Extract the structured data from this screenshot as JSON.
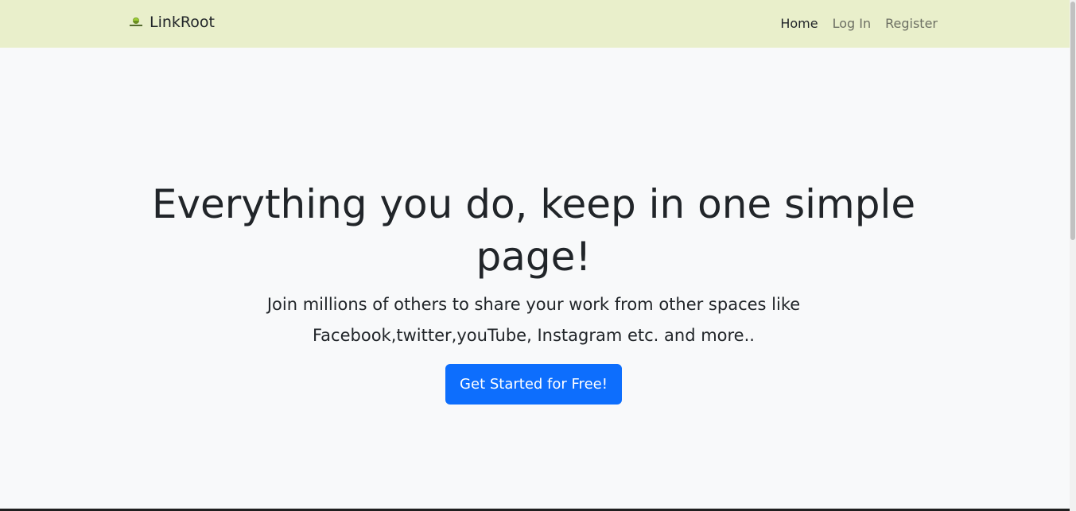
{
  "nav": {
    "brand": "LinkRoot",
    "logo_icon": "linkroot-logo-icon",
    "links": [
      {
        "label": "Home",
        "active": true
      },
      {
        "label": "Log In",
        "active": false
      },
      {
        "label": "Register",
        "active": false
      }
    ]
  },
  "hero": {
    "title": "Everything you do, keep in one simple page!",
    "subtitle": "Join millions of others to share your work from other spaces like Facebook,twitter,youTube, Instagram etc. and more..",
    "cta_label": "Get Started for Free!"
  },
  "colors": {
    "navbar_bg": "#e9efcb",
    "page_bg": "#f8f9fa",
    "button_primary": "#0d6efd"
  }
}
